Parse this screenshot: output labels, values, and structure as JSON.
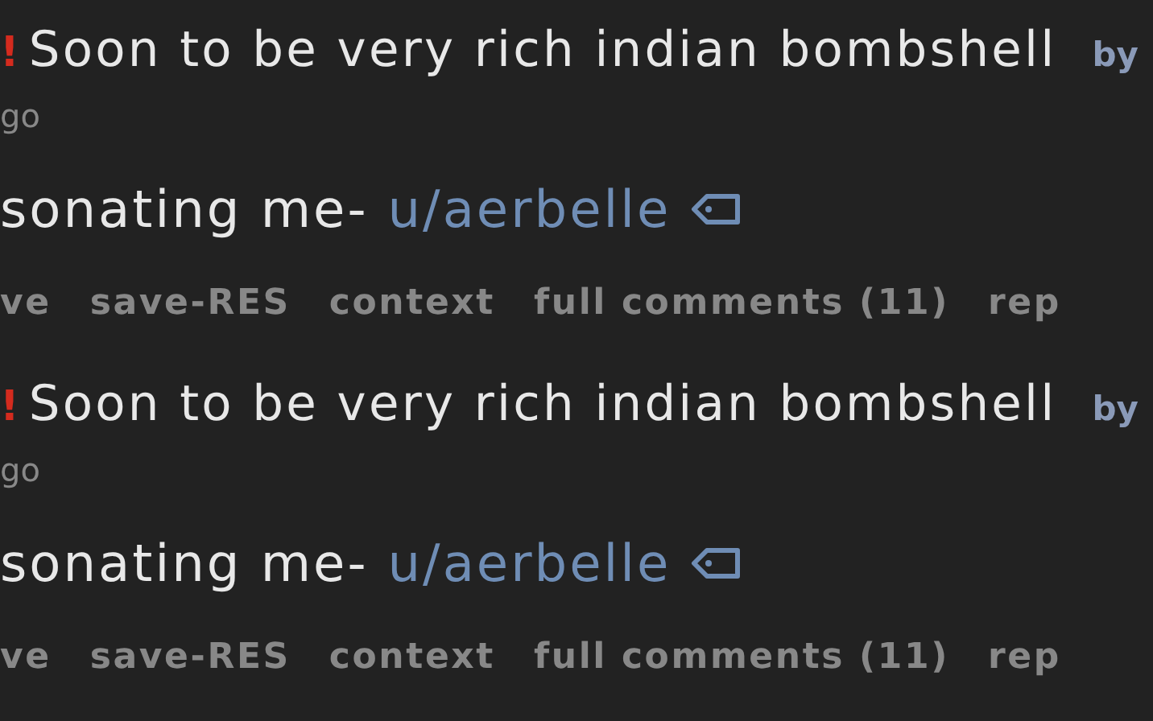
{
  "comments": [
    {
      "flair_mark": "!",
      "title": "Soon to be very rich indian bombshell",
      "author_prefix": "by",
      "age": "go",
      "body": "sonating me-",
      "user_link": "u/aerbelle",
      "actions": [
        "ve",
        "save-RES",
        "context",
        "full comments (11)",
        "rep"
      ]
    },
    {
      "flair_mark": "!",
      "title": "Soon to be very rich indian bombshell",
      "author_prefix": "by",
      "age": "go",
      "body": "sonating me-",
      "user_link": "u/aerbelle",
      "actions": [
        "ve",
        "save-RES",
        "context",
        "full comments (11)",
        "rep"
      ]
    }
  ]
}
